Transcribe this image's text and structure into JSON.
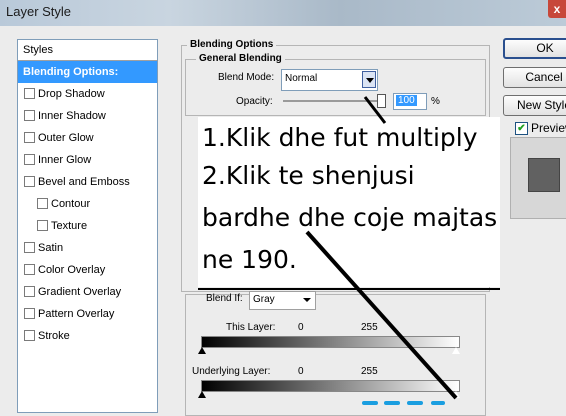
{
  "window": {
    "title": "Layer Style",
    "close_glyph": "x"
  },
  "styles_panel": {
    "header": "Styles",
    "items": [
      {
        "label": "Blending Options: Default",
        "selected": true,
        "checkbox": false,
        "indent": 0
      },
      {
        "label": "Drop Shadow",
        "checkbox": true,
        "indent": 0
      },
      {
        "label": "Inner Shadow",
        "checkbox": true,
        "indent": 0
      },
      {
        "label": "Outer Glow",
        "checkbox": true,
        "indent": 0
      },
      {
        "label": "Inner Glow",
        "checkbox": true,
        "indent": 0
      },
      {
        "label": "Bevel and Emboss",
        "checkbox": true,
        "indent": 0
      },
      {
        "label": "Contour",
        "checkbox": true,
        "indent": 1
      },
      {
        "label": "Texture",
        "checkbox": true,
        "indent": 1
      },
      {
        "label": "Satin",
        "checkbox": true,
        "indent": 0
      },
      {
        "label": "Color Overlay",
        "checkbox": true,
        "indent": 0
      },
      {
        "label": "Gradient Overlay",
        "checkbox": true,
        "indent": 0
      },
      {
        "label": "Pattern Overlay",
        "checkbox": true,
        "indent": 0
      },
      {
        "label": "Stroke",
        "checkbox": true,
        "indent": 0
      }
    ]
  },
  "blending": {
    "section_title": "Blending Options",
    "general_title": "General Blending",
    "blend_mode_label": "Blend Mode:",
    "blend_mode_value": "Normal",
    "opacity_label": "Opacity:",
    "opacity_value": "100",
    "opacity_unit": "%",
    "opacity_level": 1.0
  },
  "blend_if": {
    "label": "Blend If:",
    "channel": "Gray",
    "this_layer_label": "This Layer:",
    "this_layer_low": "0",
    "this_layer_high": "255",
    "underlying_label": "Underlying Layer:",
    "underlying_low": "0",
    "underlying_high": "255"
  },
  "buttons": {
    "ok": "OK",
    "cancel": "Cancel",
    "new_style": "New Style"
  },
  "preview": {
    "label": "Preview",
    "checked": true,
    "check_glyph": "✔"
  },
  "note": {
    "lines": [
      "1.Klik dhe fut multiply",
      "2.Klik te shenjusi",
      " bardhe dhe coje majtas",
      "ne 190."
    ]
  },
  "colors": {
    "selection": "#3399ff",
    "annotation_dashes": "#1a9ee0"
  }
}
